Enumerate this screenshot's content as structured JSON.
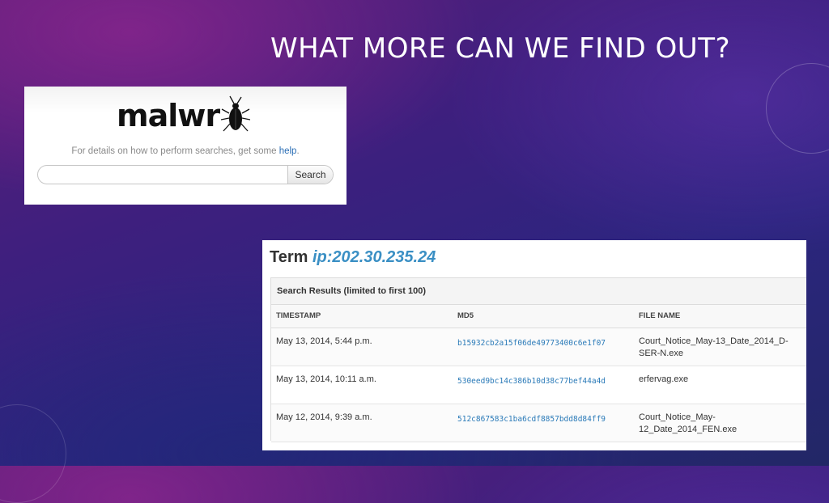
{
  "slide": {
    "title": "What more can we find out?"
  },
  "malwr": {
    "logo_text": "malwr",
    "help_text": "For details on how to perform searches, get some ",
    "help_link": "help",
    "help_suffix": ".",
    "search_placeholder": "",
    "search_button": "Search"
  },
  "results": {
    "term_label": "Term",
    "term_value": "ip:202.30.235.24",
    "header": "Search Results (limited to first 100)",
    "columns": [
      "TIMESTAMP",
      "MD5",
      "FILE NAME"
    ],
    "rows": [
      {
        "timestamp": "May 13, 2014, 5:44 p.m.",
        "md5": "b15932cb2a15f06de49773400c6e1f07",
        "file": "Court_Notice_May-13_Date_2014_D-SER-N.exe"
      },
      {
        "timestamp": "May 13, 2014, 10:11 a.m.",
        "md5": "530eed9bc14c386b10d38c77bef44a4d",
        "file": "erfervag.exe"
      },
      {
        "timestamp": "May 12, 2014, 9:39 a.m.",
        "md5": "512c867583c1ba6cdf8857bdd8d84ff9",
        "file": "Court_Notice_May-12_Date_2014_FEN.exe"
      }
    ]
  },
  "colors": {
    "link": "#2a7ab8",
    "term": "#3a8fc4"
  }
}
